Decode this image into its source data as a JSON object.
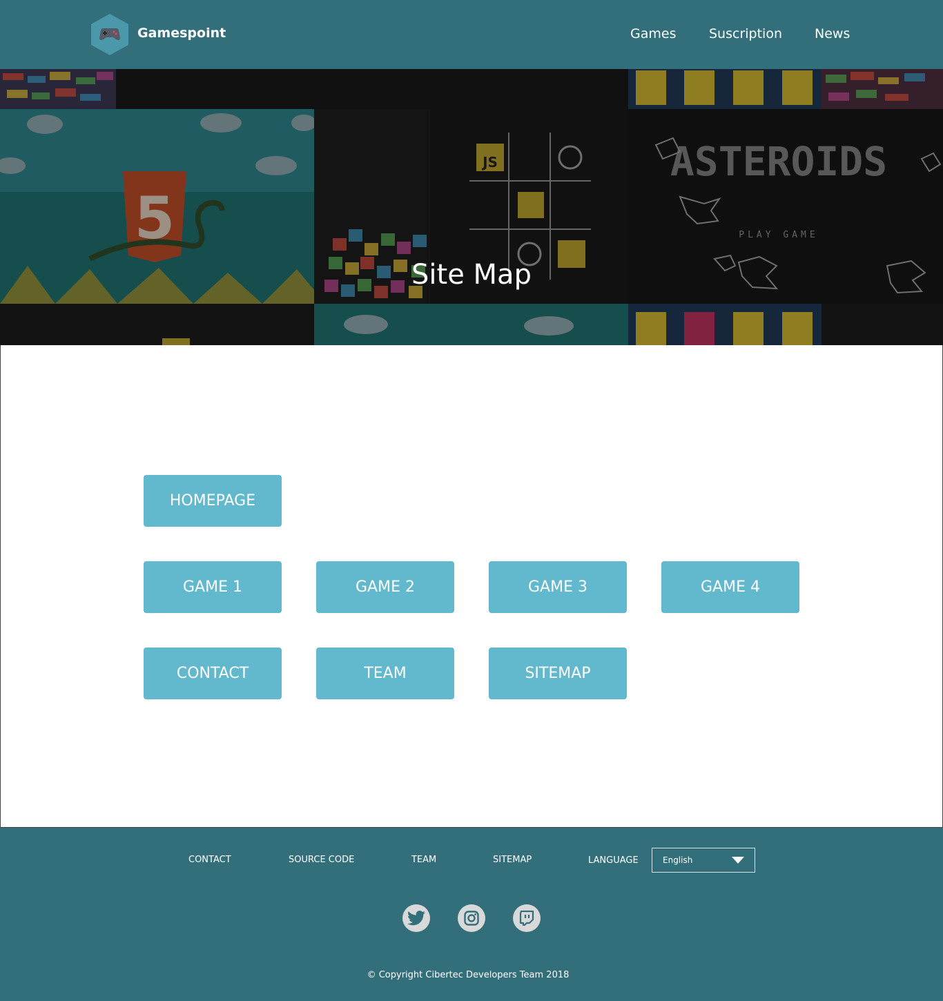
{
  "header": {
    "brand": "Gamespoint",
    "nav": [
      "Games",
      "Suscription",
      "News"
    ]
  },
  "hero": {
    "title": "Site Map",
    "tile_text": {
      "asteroids": "ASTEROIDS",
      "play_game": "PLAY GAME",
      "js": "JS",
      "html5": "5"
    }
  },
  "sitemap": {
    "homepage": "HOMEPAGE",
    "games": [
      "GAME 1",
      "GAME 2",
      "GAME 3",
      "GAME 4"
    ],
    "contact": "CONTACT",
    "team": "TEAM",
    "sitemap": "SITEMAP"
  },
  "footer": {
    "links": [
      "CONTACT",
      "SOURCE CODE",
      "TEAM",
      "SITEMAP"
    ],
    "language_label": "LANGUAGE",
    "language_value": "English",
    "social": [
      "twitter-icon",
      "instagram-icon",
      "twitch-icon"
    ],
    "copyright": "© Copyright Cibertec Developers Team 2018"
  },
  "colors": {
    "header": "#336f7a",
    "button": "#62b8cd",
    "footer": "#336f7a",
    "social": "#d9d9d9"
  }
}
